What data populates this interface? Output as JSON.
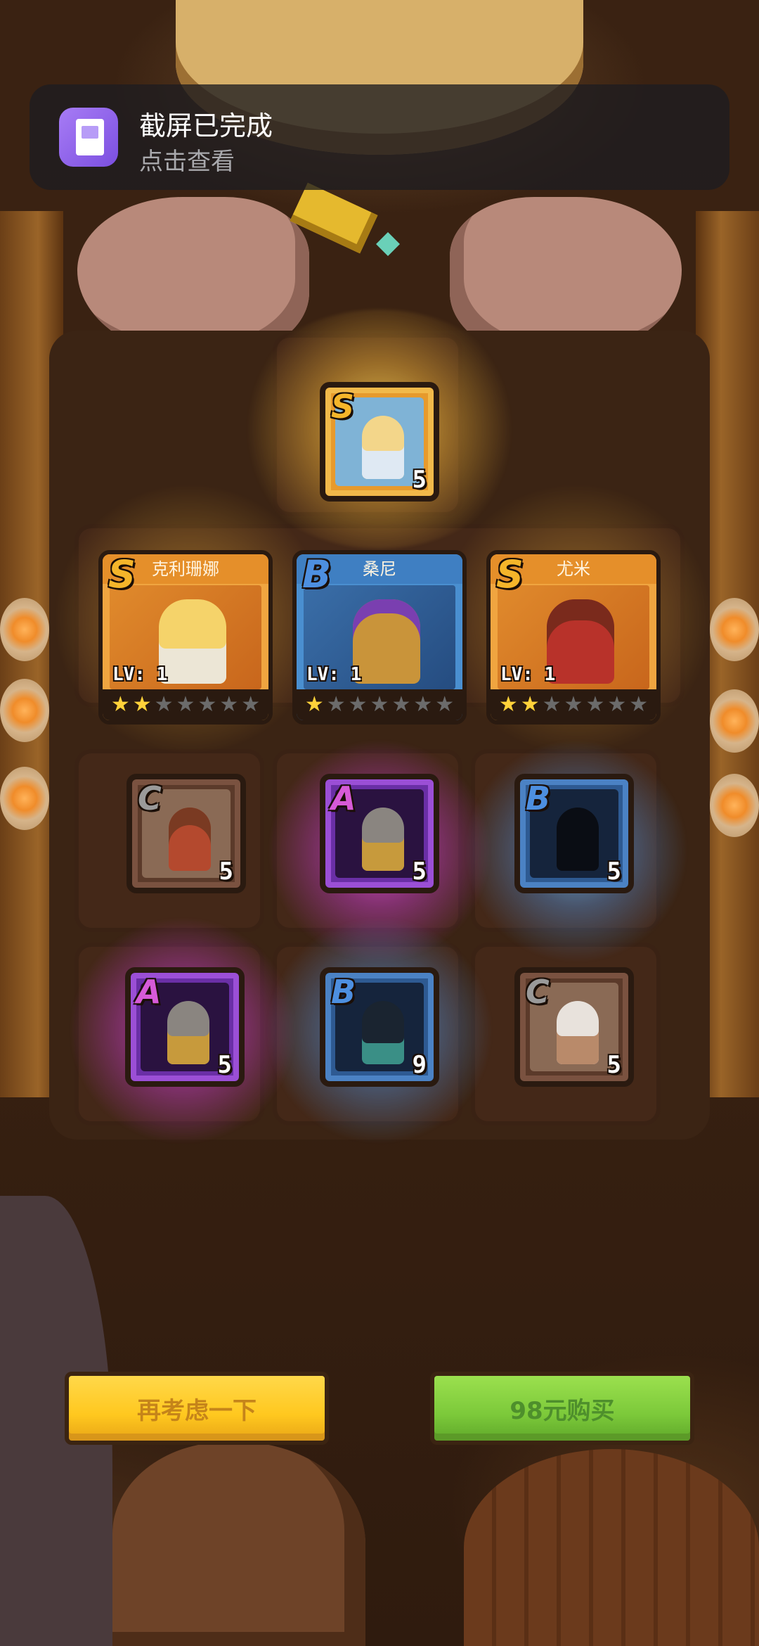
{
  "notification": {
    "title": "截屏已完成",
    "subtitle": "点击查看",
    "icon": "screenshot-gallery-icon"
  },
  "featured_card": {
    "rank": "S",
    "count": "5",
    "character": "light-blue-hero"
  },
  "hero_cards": [
    {
      "rank": "S",
      "name": "克利珊娜",
      "level": "LV: 1",
      "stars_filled": 2,
      "stars_total": 7
    },
    {
      "rank": "B",
      "name": "桑尼",
      "level": "LV: 1",
      "stars_filled": 1,
      "stars_total": 7
    },
    {
      "rank": "S",
      "name": "尤米",
      "level": "LV: 1",
      "stars_filled": 2,
      "stars_total": 7
    }
  ],
  "item_cards_row1": [
    {
      "rank": "C",
      "count": "5"
    },
    {
      "rank": "A",
      "count": "5"
    },
    {
      "rank": "B",
      "count": "5"
    }
  ],
  "item_cards_row2": [
    {
      "rank": "A",
      "count": "5"
    },
    {
      "rank": "B",
      "count": "9"
    },
    {
      "rank": "C",
      "count": "5"
    }
  ],
  "buttons": {
    "reconsider": "再考虑一下",
    "buy": "98元购买"
  },
  "colors": {
    "rank_S": "#f5b52a",
    "rank_A": "#d65ad8",
    "rank_B": "#4d8fe0",
    "rank_C": "#9a9a9a",
    "button_yellow": "#ffc81f",
    "button_green": "#7cc93a"
  }
}
